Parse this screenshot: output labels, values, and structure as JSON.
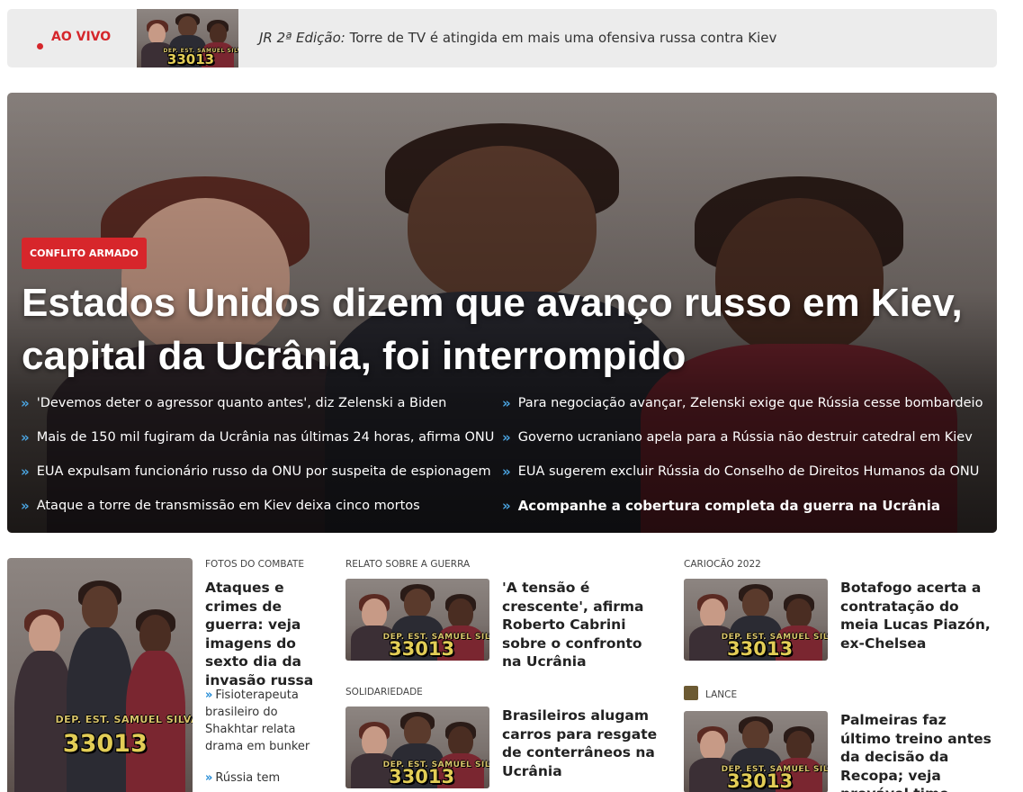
{
  "live": {
    "label": "AO VIVO",
    "program": "JR 2ª Edição:",
    "headline": "Torre de TV é atingida em mais uma ofensiva russa contra Kiev"
  },
  "hero": {
    "tag": "CONFLITO ARMADO",
    "title": "Estados Unidos dizem que avanço russo em Kiev, capital da Ucrânia, foi interrompido",
    "links_left": [
      "'Devemos deter o agressor quanto antes', diz Zelenski a Biden",
      "Mais de 150 mil fugiram da Ucrânia nas últimas 24 horas, afirma ONU",
      "EUA expulsam funcionário russo da ONU por suspeita de espionagem",
      "Ataque a torre de transmissão em Kiev deixa cinco mortos"
    ],
    "links_right": [
      "Para negociação avançar, Zelenski exige que Rússia cesse bombardeio",
      "Governo ucraniano apela para a Rússia não destruir catedral em Kiev",
      "EUA sugerem excluir Rússia do Conselho de Direitos Humanos da ONU",
      "Acompanhe a cobertura completa da guerra na Ucrânia"
    ]
  },
  "image_text": {
    "line1": "DEP. EST. SAMUEL SILVA",
    "line2": "33013"
  },
  "featured": {
    "kicker": "FOTOS DO COMBATE",
    "title": "Ataques e crimes de guerra: veja imagens do sexto dia da invasão russa",
    "subs": [
      "Fisioterapeuta brasileiro do Shakhtar relata drama em bunker",
      "Rússia tem"
    ]
  },
  "cards": [
    {
      "kicker": "RELATO SOBRE A GUERRA",
      "title": "'A tensão é crescente', afirma Roberto Cabrini sobre o confronto na Ucrânia"
    },
    {
      "kicker": "SOLIDARIEDADE",
      "title": "Brasileiros alugam carros para resgate de conterrâneos na Ucrânia"
    },
    {
      "kicker": "CARIOCÃO 2022",
      "title": "Botafogo acerta a contratação do meia Lucas Piazón, ex-Chelsea"
    },
    {
      "kicker": "LANCE",
      "title": "Palmeiras faz último treino antes da decisão da Recopa; veja provável time"
    }
  ],
  "colors": {
    "accent_red": "#d7262b",
    "link_chevron": "#4aa3df",
    "live_bar_bg": "#ececec"
  }
}
